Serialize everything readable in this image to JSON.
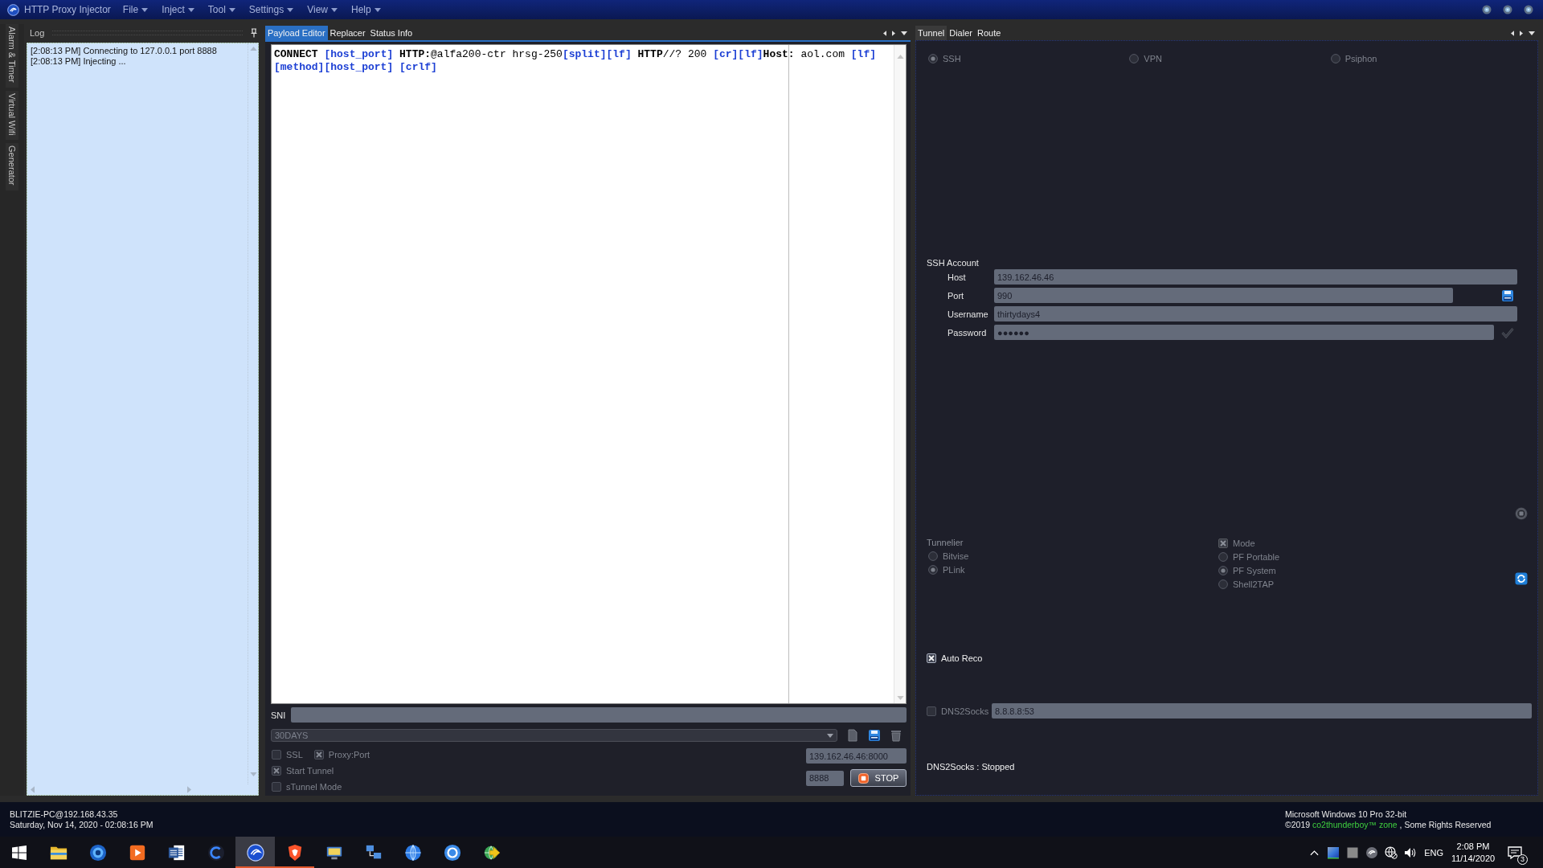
{
  "window": {
    "title": "HTTP Proxy Injector",
    "menu": [
      "File",
      "Inject",
      "Tool",
      "Settings",
      "View",
      "Help"
    ]
  },
  "side_tabs": [
    "Alarm & Timer",
    "Virtual Wifi",
    "Generator"
  ],
  "log": {
    "title": "Log",
    "lines": [
      "[2:08:13 PM] Connecting to 127.0.0.1 port 8888",
      "[2:08:13 PM] Injecting ..."
    ]
  },
  "payload": {
    "tabs": [
      {
        "label": "Payload Editor",
        "selected": true
      },
      {
        "label": "Replacer",
        "selected": false
      },
      {
        "label": "Status Info",
        "selected": false
      }
    ],
    "editor_lines": [
      [
        {
          "kind": "keyword",
          "text": "CONNECT "
        },
        {
          "kind": "tag",
          "text": "[host_port]"
        },
        {
          "kind": "keyword",
          "text": " HTTP:"
        },
        {
          "kind": "plain",
          "text": "@alfa200-ctr hrsg-250"
        },
        {
          "kind": "tag",
          "text": "[split][lf]"
        },
        {
          "kind": "keyword",
          "text": " HTTP"
        },
        {
          "kind": "plain",
          "text": "//? 200 "
        },
        {
          "kind": "tag",
          "text": "[cr][lf]"
        },
        {
          "kind": "keyword",
          "text": "Host:"
        },
        {
          "kind": "plain",
          "text": " aol.com "
        },
        {
          "kind": "tag",
          "text": "[lf]"
        }
      ],
      [
        {
          "kind": "tag",
          "text": "[method][host_port] [crlf]"
        }
      ]
    ],
    "sni": {
      "label": "SNI"
    },
    "profile": {
      "value": "30DAYS"
    },
    "option_rows": [
      [
        {
          "label": "SSL",
          "checked": false,
          "disabled": true
        },
        {
          "label": "Proxy:Port",
          "checked": true,
          "disabled": true
        }
      ],
      [
        {
          "label": "Start Tunnel",
          "checked": true,
          "disabled": true
        }
      ],
      [
        {
          "label": "sTunnel Mode",
          "checked": false,
          "disabled": true
        }
      ]
    ],
    "proxy": {
      "value": "139.162.46.46:8000"
    },
    "local_port": {
      "value": "8888"
    },
    "stop_button": "STOP"
  },
  "tunnel": {
    "tabs": [
      {
        "label": "Tunnel",
        "selected": true
      },
      {
        "label": "Dialer",
        "selected": false
      },
      {
        "label": "Route",
        "selected": false
      }
    ],
    "types": [
      {
        "label": "SSH",
        "selected": true,
        "disabled": true
      },
      {
        "label": "VPN",
        "selected": false,
        "disabled": true
      },
      {
        "label": "Psiphon",
        "selected": false,
        "disabled": true
      }
    ],
    "account": {
      "title": "SSH Account",
      "fields": [
        {
          "label": "Host",
          "value": "139.162.46.46",
          "kind": "text"
        },
        {
          "label": "Port",
          "value": "990",
          "kind": "save"
        },
        {
          "label": "Username",
          "value": "thirtydays4",
          "kind": "text"
        },
        {
          "label": "Password",
          "value": "●●●●●●",
          "kind": "check"
        }
      ]
    },
    "tunnelier": {
      "title": "Tunnelier",
      "options": [
        {
          "label": "Bitvise",
          "selected": false,
          "disabled": true
        },
        {
          "label": "PLink",
          "selected": true,
          "disabled": true
        }
      ]
    },
    "mode": {
      "label": "Mode",
      "checked": true,
      "disabled": true,
      "options": [
        {
          "label": "PF Portable",
          "selected": false,
          "disabled": true
        },
        {
          "label": "PF System",
          "selected": true,
          "disabled": true
        },
        {
          "label": "Shell2TAP",
          "selected": false,
          "disabled": true
        }
      ]
    },
    "auto_reconnect": {
      "label": "Auto Reco",
      "checked": true,
      "disabled": false
    },
    "dns2socks": {
      "label": "DNS2Socks",
      "checked": false,
      "disabled": true,
      "value": "8.8.8.8:53"
    },
    "status": "DNS2Socks : Stopped"
  },
  "status_bar": {
    "host": "BLITZIE-PC@192.168.43.35",
    "datetime": "Saturday, Nov 14, 2020 - 02:08:16 PM",
    "os": "Microsoft Windows 10 Pro 32-bit",
    "copyright": {
      "prefix": "©2019",
      "link": "co2thunderboy™ zone",
      "suffix": ", Some Rights Reserved"
    }
  },
  "taskbar": {
    "apps": [
      {
        "selected": false,
        "running": false
      },
      {
        "selected": false,
        "running": false
      },
      {
        "selected": false,
        "running": false
      },
      {
        "selected": false,
        "running": false
      },
      {
        "selected": false,
        "running": false
      },
      {
        "selected": true,
        "running": true
      },
      {
        "selected": false,
        "running": true
      },
      {
        "selected": false,
        "running": false
      },
      {
        "selected": false,
        "running": false
      },
      {
        "selected": false,
        "running": false
      },
      {
        "selected": false,
        "running": false
      },
      {
        "selected": false,
        "running": false
      }
    ],
    "tray": {
      "language": "ENG",
      "time": "2:08 PM",
      "date": "11/14/2020",
      "notifications": "3"
    }
  }
}
